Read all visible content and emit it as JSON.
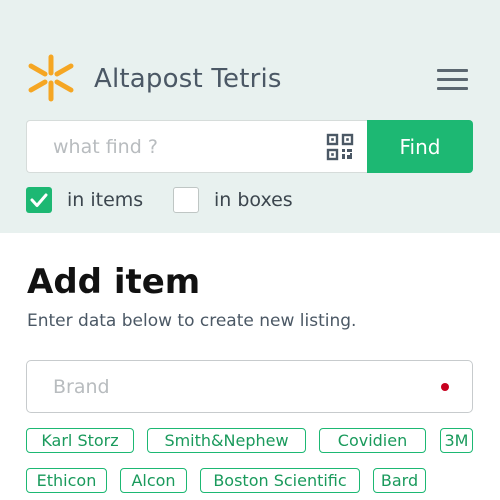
{
  "header": {
    "title": "Altapost Tetris",
    "logo_icon": "asterisk-logo-icon",
    "menu_icon": "hamburger-menu-icon"
  },
  "search": {
    "placeholder": "what find ?",
    "value": "",
    "scan_icon": "qr-code-icon",
    "find_label": "Find"
  },
  "filters": [
    {
      "label": "in items",
      "checked": true
    },
    {
      "label": "in boxes",
      "checked": false
    }
  ],
  "form": {
    "title": "Add item",
    "subtitle": "Enter data below to create new listing.",
    "brand_placeholder": "Brand",
    "brand_value": ""
  },
  "brand_suggestions": [
    "Karl Storz",
    "Smith&Nephew",
    "Covidien",
    "3M",
    "Ethicon",
    "Alcon",
    "Boston Scientific",
    "Bard"
  ],
  "colors": {
    "accent": "#1db873",
    "logo": "#f5a623",
    "header_bg": "#e8f1ef",
    "required": "#c7001f"
  }
}
